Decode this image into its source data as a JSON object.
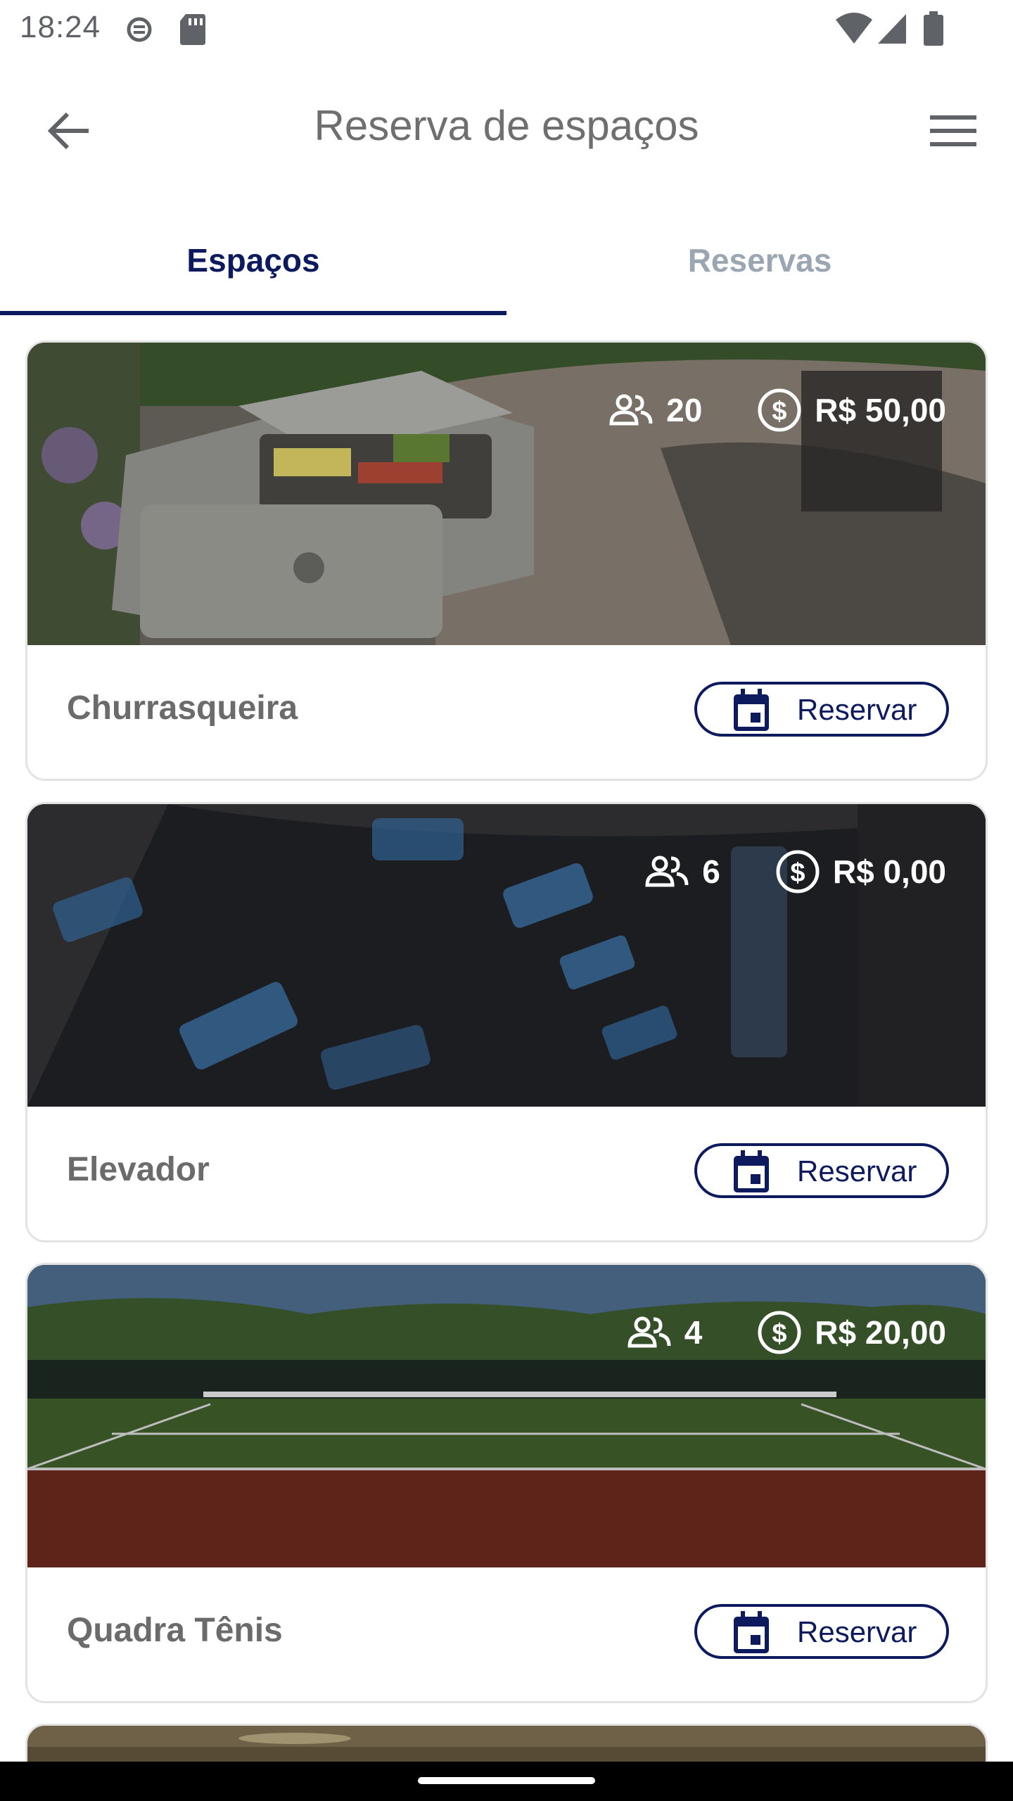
{
  "status_bar": {
    "time": "18:24",
    "icons": [
      "data-saver-icon",
      "sd-card-icon",
      "wifi-icon",
      "cell-signal-icon",
      "battery-icon"
    ]
  },
  "app_bar": {
    "title": "Reserva de espaços",
    "back_icon": "arrow-back-icon",
    "menu_icon": "hamburger-menu-icon"
  },
  "tabs": [
    {
      "label": "Espaços",
      "active": true
    },
    {
      "label": "Reservas",
      "active": false
    }
  ],
  "spaces": [
    {
      "name": "Churrasqueira",
      "capacity": "20",
      "price": "R$ 50,00",
      "reserve_label": "Reservar",
      "image": "bbq-grill-photo"
    },
    {
      "name": "Elevador",
      "capacity": "6",
      "price": "R$ 0,00",
      "reserve_label": "Reservar",
      "image": "elevator-buttons-photo"
    },
    {
      "name": "Quadra Tênis",
      "capacity": "4",
      "price": "R$ 20,00",
      "reserve_label": "Reservar",
      "image": "tennis-court-photo"
    }
  ],
  "colors": {
    "primary": "#0d1b5e",
    "tab_inactive": "#9aa7b2",
    "title_gray": "#6f6f6f",
    "card_border": "#e3e3e3"
  }
}
